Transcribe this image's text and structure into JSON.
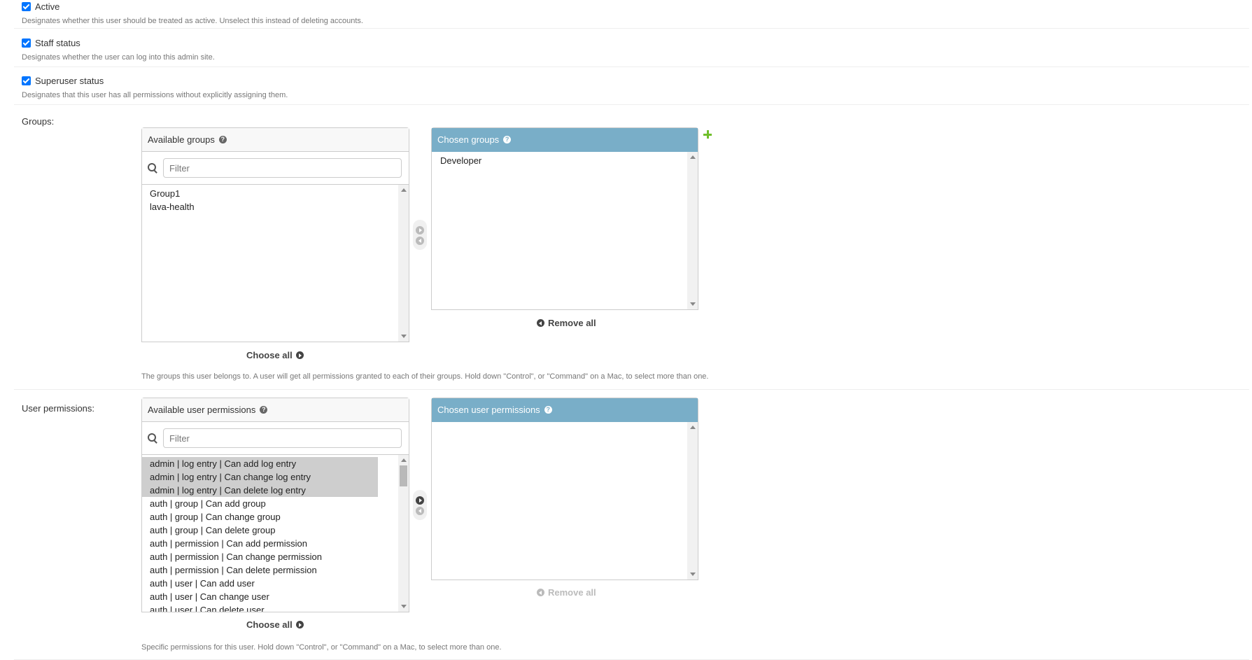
{
  "flags": [
    {
      "label": "Active",
      "help": "Designates whether this user should be treated as active. Unselect this instead of deleting accounts.",
      "checked": true
    },
    {
      "label": "Staff status",
      "help": "Designates whether the user can log into this admin site.",
      "checked": true
    },
    {
      "label": "Superuser status",
      "help": "Designates that this user has all permissions without explicitly assigning them.",
      "checked": true
    }
  ],
  "groups": {
    "label": "Groups:",
    "available_title": "Available groups",
    "filter_placeholder": "Filter",
    "available": [
      "Group1",
      "lava-health"
    ],
    "chosen_title": "Chosen groups",
    "chosen": [
      "Developer"
    ],
    "choose_all": "Choose all",
    "remove_all": "Remove all",
    "help": "The groups this user belongs to. A user will get all permissions granted to each of their groups. Hold down \"Control\", or \"Command\" on a Mac, to select more than one."
  },
  "permissions": {
    "label": "User permissions:",
    "available_title": "Available user permissions",
    "filter_placeholder": "Filter",
    "available": [
      "admin | log entry | Can add log entry",
      "admin | log entry | Can change log entry",
      "admin | log entry | Can delete log entry",
      "auth | group | Can add group",
      "auth | group | Can change group",
      "auth | group | Can delete group",
      "auth | permission | Can add permission",
      "auth | permission | Can change permission",
      "auth | permission | Can delete permission",
      "auth | user | Can add user",
      "auth | user | Can change user",
      "auth | user | Can delete user"
    ],
    "selected_count": 3,
    "chosen_title": "Chosen user permissions",
    "chosen": [],
    "choose_all": "Choose all",
    "remove_all": "Remove all",
    "help": "Specific permissions for this user. Hold down \"Control\", or \"Command\" on a Mac, to select more than one."
  }
}
